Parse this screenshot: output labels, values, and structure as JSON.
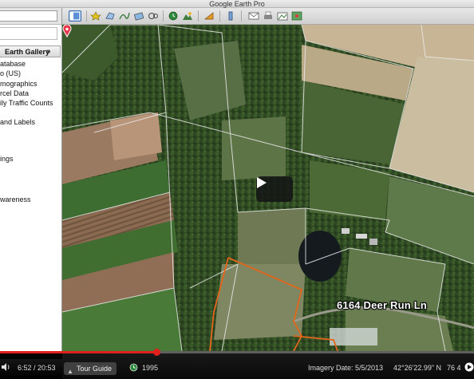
{
  "window": {
    "title": "Google Earth Pro"
  },
  "toolbar": {
    "icons": [
      "sidebar-toggle-icon",
      "placemark-icon",
      "polygon-icon",
      "path-icon",
      "image-overlay-icon",
      "tour-record-icon",
      "historical-imagery-icon",
      "sunlight-icon",
      "planets-icon",
      "ruler-icon",
      "email-icon",
      "print-icon",
      "save-image-icon",
      "maps-icon"
    ]
  },
  "sidebar": {
    "gallery_button": "Earth Gallery",
    "gallery_arrow": "»",
    "layers": [
      "atabase",
      "o (US)",
      "mographics",
      "rcel Data",
      "ily Traffic Counts",
      "and Labels",
      "ings",
      "wareness"
    ]
  },
  "map": {
    "placemark_label": "6164 Deer Run Ln",
    "placemark_color": "#e8364a",
    "boundary_color": "#e2661c"
  },
  "statusbar": {
    "tour_guide": "Tour Guide",
    "historical_year": "1995",
    "imagery_date": "Imagery Date: 5/5/2013",
    "latitude": "42°26'22.99\" N",
    "longitude": "76 4"
  },
  "video": {
    "time": "6:52 / 20:53",
    "progress": 0.33,
    "accent_color": "#e0201a"
  }
}
